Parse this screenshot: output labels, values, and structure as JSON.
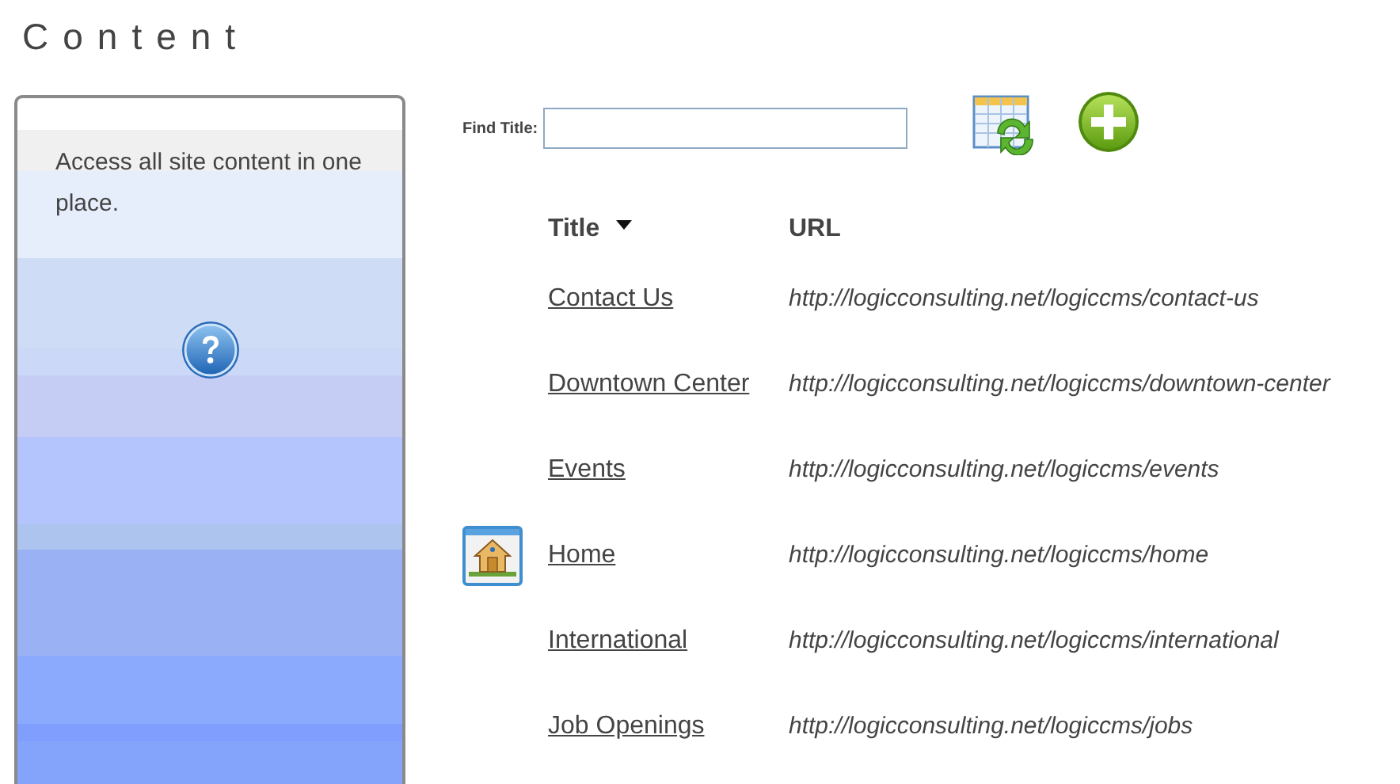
{
  "page_title": "Content",
  "help_panel": {
    "text": "Access all site content in one place."
  },
  "search": {
    "label": "Find Title:"
  },
  "table": {
    "columns": [
      {
        "label": "Title",
        "sorted": true
      },
      {
        "label": "URL",
        "sorted": false
      }
    ],
    "rows": [
      {
        "title": "Contact Us",
        "url": "http://logicconsulting.net/logiccms/contact-us",
        "home": false
      },
      {
        "title": "Downtown Center",
        "url": "http://logicconsulting.net/logiccms/downtown-center",
        "home": false
      },
      {
        "title": "Events",
        "url": "http://logicconsulting.net/logiccms/events",
        "home": false
      },
      {
        "title": "Home",
        "url": "http://logicconsulting.net/logiccms/home",
        "home": true
      },
      {
        "title": "International",
        "url": "http://logicconsulting.net/logiccms/international",
        "home": false
      },
      {
        "title": "Job Openings",
        "url": "http://logicconsulting.net/logiccms/jobs",
        "home": false
      }
    ]
  }
}
